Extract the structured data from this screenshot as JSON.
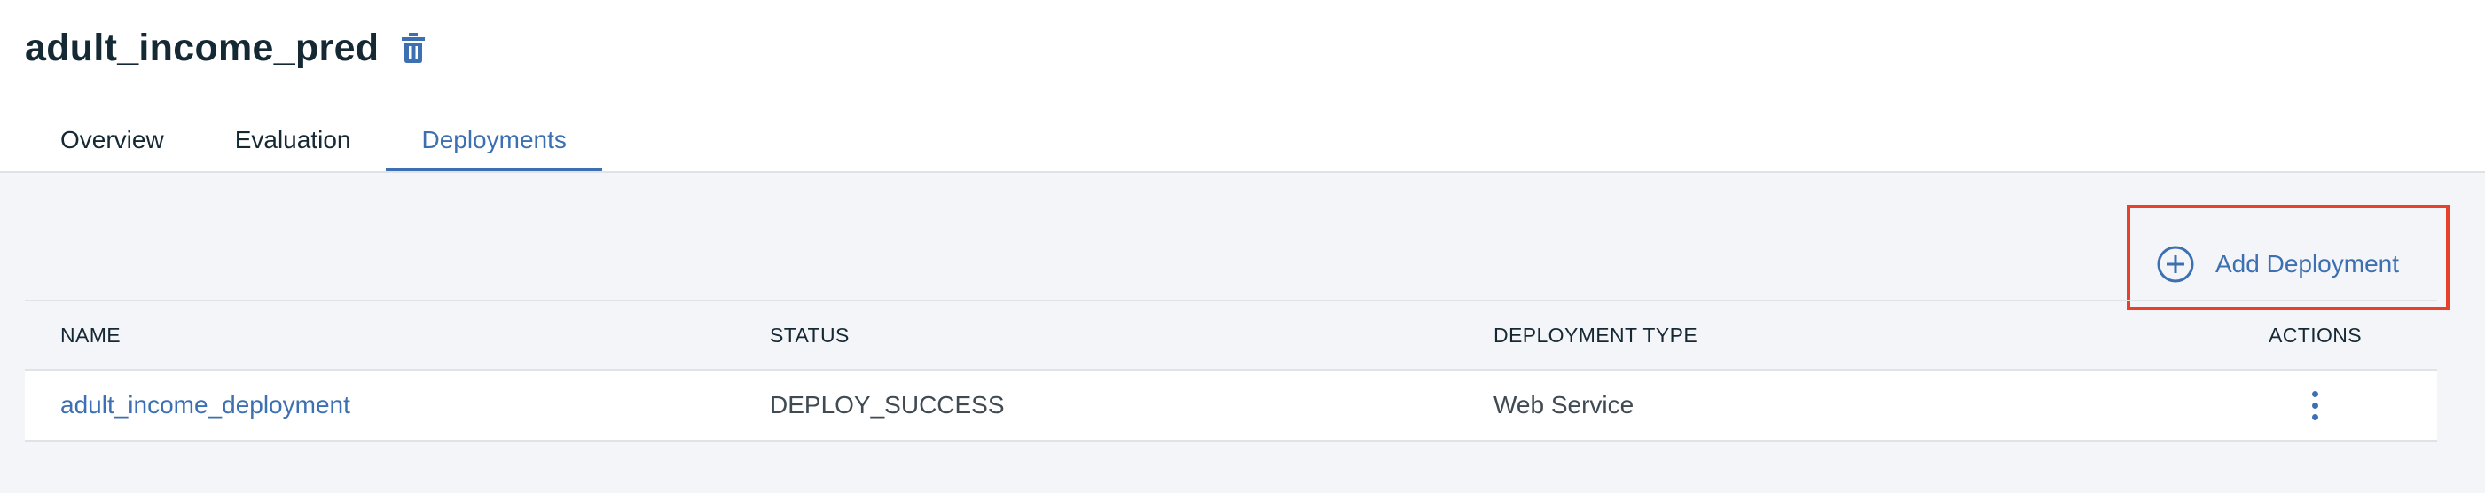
{
  "page": {
    "title": "adult_income_pred",
    "delete_icon": "trash-icon"
  },
  "tabs": [
    {
      "label": "Overview",
      "active": false
    },
    {
      "label": "Evaluation",
      "active": false
    },
    {
      "label": "Deployments",
      "active": true
    }
  ],
  "toolbar": {
    "add_deployment_label": "Add Deployment",
    "add_icon": "plus-circle-icon",
    "highlight_color": "#e8412b"
  },
  "table": {
    "columns": [
      "NAME",
      "STATUS",
      "DEPLOYMENT TYPE",
      "ACTIONS"
    ],
    "rows": [
      {
        "name": "adult_income_deployment",
        "status": "DEPLOY_SUCCESS",
        "deployment_type": "Web Service",
        "actions_icon": "overflow-menu-vertical-icon"
      }
    ]
  },
  "colors": {
    "accent": "#3d70b2",
    "text": "#152935",
    "background": "#f4f5f8"
  }
}
